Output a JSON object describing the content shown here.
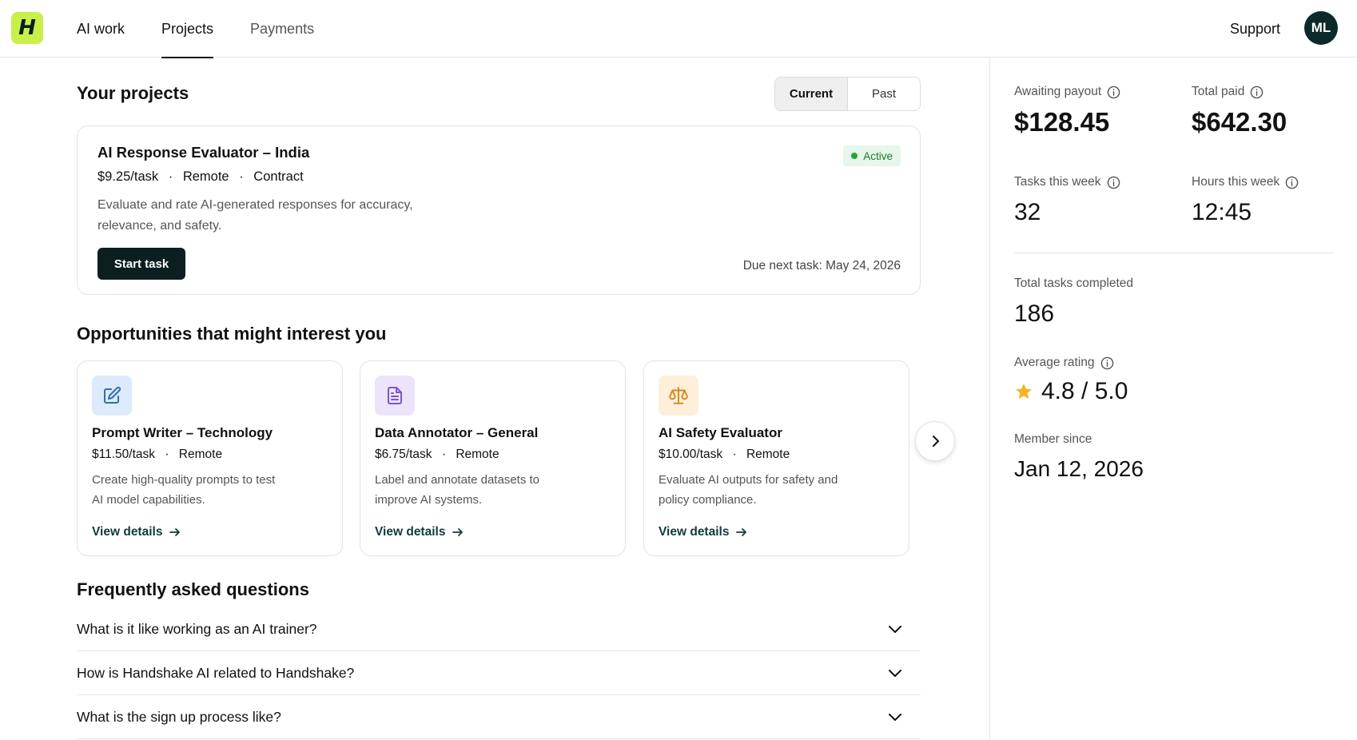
{
  "nav": {
    "logo_letter": "H",
    "items": [
      {
        "label": "AI work",
        "state": "normal"
      },
      {
        "label": "Projects",
        "state": "active"
      },
      {
        "label": "Payments",
        "state": "inactive"
      }
    ],
    "support_label": "Support",
    "avatar_initials": "ML"
  },
  "projects": {
    "title": "Your projects",
    "tabs": [
      "Current",
      "Past"
    ],
    "selected_tab": "Current",
    "card": {
      "title": "AI Response Evaluator – India",
      "rate": "$9.25/task",
      "location": "Remote",
      "type": "Contract",
      "description": "Evaluate and rate AI-generated responses for accuracy, relevance, and safety.",
      "status": "Active",
      "start_label": "Start task",
      "due_text": "Due next task: May 24, 2026"
    }
  },
  "opportunities": {
    "title": "Opportunities that might interest you",
    "link_label": "View details",
    "items": [
      {
        "name": "Prompt Writer – Technology",
        "rate": "$11.50/task",
        "location": "Remote",
        "description": "Create high-quality prompts to test AI model capabilities.",
        "icon": "edit-icon",
        "icon_bg": "#dcebfb",
        "icon_color": "#2f6db5"
      },
      {
        "name": "Data Annotator – General",
        "rate": "$6.75/task",
        "location": "Remote",
        "description": "Label and annotate datasets to improve AI systems.",
        "icon": "document-icon",
        "icon_bg": "#ece4fb",
        "icon_color": "#7b55c9"
      },
      {
        "name": "AI Safety Evaluator",
        "rate": "$10.00/task",
        "location": "Remote",
        "description": "Evaluate AI outputs for safety and policy compliance.",
        "icon": "scales-icon",
        "icon_bg": "#fdefd9",
        "icon_color": "#d98a1c"
      }
    ]
  },
  "faq": {
    "title": "Frequently asked questions",
    "items": [
      "What is it like working as an AI trainer?",
      "How is Handshake AI related to Handshake?",
      "What is the sign up process like?"
    ]
  },
  "stats": {
    "awaiting_payout_label": "Awaiting payout",
    "awaiting_payout": "$128.45",
    "total_paid_label": "Total paid",
    "total_paid": "$642.30",
    "tasks_week_label": "Tasks this week",
    "tasks_week": "32",
    "hours_week_label": "Hours this week",
    "hours_week": "12:45",
    "total_completed_label": "Total tasks completed",
    "total_completed": "186",
    "rating_label": "Average rating",
    "rating": "4.8 / 5.0",
    "member_since_label": "Member since",
    "member_since": "Jan 12, 2026"
  },
  "colors": {
    "logo_bg": "#c9f04a",
    "primary_dark": "#0b1f20",
    "active_green": "#27a33c",
    "star": "#f4b324"
  }
}
